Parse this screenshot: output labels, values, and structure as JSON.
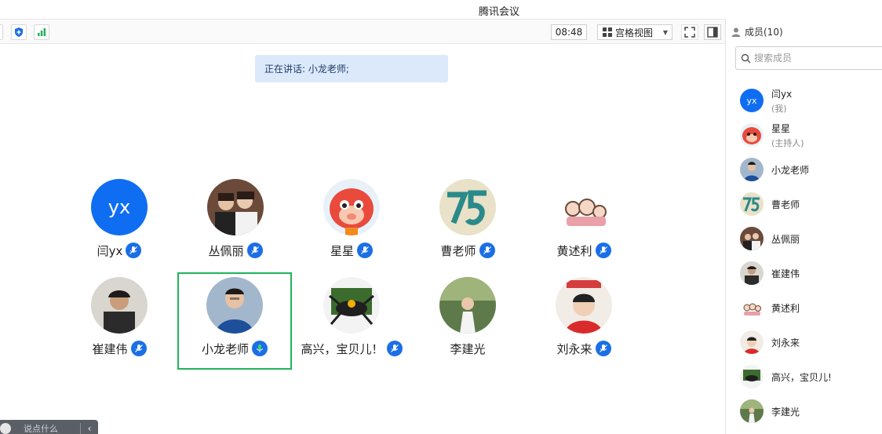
{
  "window": {
    "title": "腾讯会议"
  },
  "toolbar": {
    "clock": "08:48",
    "view_label": "宫格视图",
    "view_icon": "grid-icon"
  },
  "speaking": {
    "text": "正在讲话: 小龙老师;"
  },
  "tiles": [
    {
      "name": "闫yx",
      "initials": "yx",
      "mic": "muted"
    },
    {
      "name": "丛佩丽",
      "mic": "muted"
    },
    {
      "name": "星星",
      "mic": "muted"
    },
    {
      "name": "曹老师",
      "mic": "muted"
    },
    {
      "name": "黄述利",
      "mic": "muted"
    },
    {
      "name": "崔建伟",
      "mic": "muted"
    },
    {
      "name": "小龙老师",
      "mic": "speaking"
    },
    {
      "name": "高兴，宝贝儿！",
      "mic": "muted"
    },
    {
      "name": "李建光",
      "mic": "none"
    },
    {
      "name": "刘永来",
      "mic": "muted"
    }
  ],
  "panel": {
    "header": "成员(10)",
    "search_placeholder": "搜索成员",
    "members": [
      {
        "name": "闫yx",
        "role": "(我)",
        "initials": "yx"
      },
      {
        "name": "星星",
        "role": "(主持人)"
      },
      {
        "name": "小龙老师"
      },
      {
        "name": "曹老师"
      },
      {
        "name": "丛佩丽"
      },
      {
        "name": "崔建伟"
      },
      {
        "name": "黄述利"
      },
      {
        "name": "刘永来"
      },
      {
        "name": "高兴，宝贝儿!"
      },
      {
        "name": "李建光"
      }
    ]
  },
  "chat": {
    "placeholder": "说点什么"
  },
  "colors": {
    "accent": "#0f6df2",
    "active_border": "#1fb35c",
    "speaking_bg": "#dbe9fb"
  }
}
